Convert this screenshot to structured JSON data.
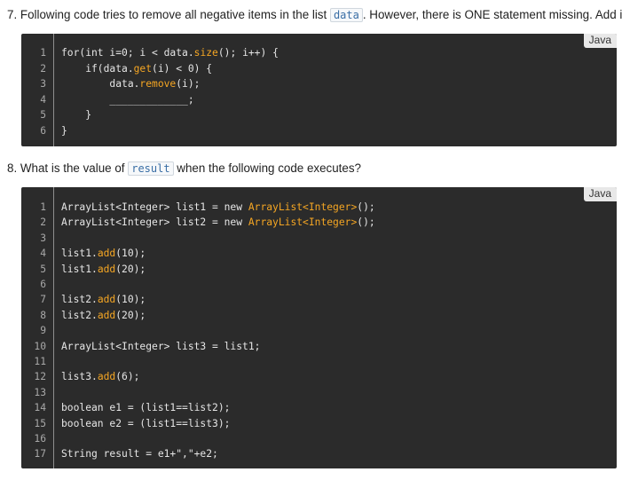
{
  "q7": {
    "prefix": "7. Following code tries to remove all negative items in the list ",
    "inline_code": "data",
    "suffix": ". However, there is ONE statement missing. Add it.",
    "language": "Java",
    "lines": [
      {
        "num": "1",
        "parts": [
          {
            "t": "for(int i=0; i < data.",
            "c": "plain"
          },
          {
            "t": "size",
            "c": "orange"
          },
          {
            "t": "(); i++) {",
            "c": "plain"
          }
        ]
      },
      {
        "num": "2",
        "parts": [
          {
            "t": "    if(data.",
            "c": "plain"
          },
          {
            "t": "get",
            "c": "orange"
          },
          {
            "t": "(i) < 0) {",
            "c": "plain"
          }
        ]
      },
      {
        "num": "3",
        "parts": [
          {
            "t": "        data.",
            "c": "plain"
          },
          {
            "t": "remove",
            "c": "orange"
          },
          {
            "t": "(i);",
            "c": "plain"
          }
        ]
      },
      {
        "num": "4",
        "parts": [
          {
            "t": "        _____________;",
            "c": "plain"
          }
        ]
      },
      {
        "num": "5",
        "parts": [
          {
            "t": "    }",
            "c": "plain"
          }
        ]
      },
      {
        "num": "6",
        "parts": [
          {
            "t": "}",
            "c": "plain"
          }
        ]
      }
    ]
  },
  "q8": {
    "prefix": "8. What is the value of ",
    "inline_code": "result",
    "suffix": " when the following code executes?",
    "language": "Java",
    "lines": [
      {
        "num": "1",
        "parts": [
          {
            "t": "ArrayList<Integer> list1 = new ",
            "c": "plain"
          },
          {
            "t": "ArrayList<Integer>",
            "c": "orange"
          },
          {
            "t": "();",
            "c": "plain"
          }
        ]
      },
      {
        "num": "2",
        "parts": [
          {
            "t": "ArrayList<Integer> list2 = new ",
            "c": "plain"
          },
          {
            "t": "ArrayList<Integer>",
            "c": "orange"
          },
          {
            "t": "();",
            "c": "plain"
          }
        ]
      },
      {
        "num": "3",
        "parts": []
      },
      {
        "num": "4",
        "parts": [
          {
            "t": "list1.",
            "c": "plain"
          },
          {
            "t": "add",
            "c": "orange"
          },
          {
            "t": "(10);",
            "c": "plain"
          }
        ]
      },
      {
        "num": "5",
        "parts": [
          {
            "t": "list1.",
            "c": "plain"
          },
          {
            "t": "add",
            "c": "orange"
          },
          {
            "t": "(20);",
            "c": "plain"
          }
        ]
      },
      {
        "num": "6",
        "parts": []
      },
      {
        "num": "7",
        "parts": [
          {
            "t": "list2.",
            "c": "plain"
          },
          {
            "t": "add",
            "c": "orange"
          },
          {
            "t": "(10);",
            "c": "plain"
          }
        ]
      },
      {
        "num": "8",
        "parts": [
          {
            "t": "list2.",
            "c": "plain"
          },
          {
            "t": "add",
            "c": "orange"
          },
          {
            "t": "(20);",
            "c": "plain"
          }
        ]
      },
      {
        "num": "9",
        "parts": []
      },
      {
        "num": "10",
        "parts": [
          {
            "t": "ArrayList<Integer> list3 = list1;",
            "c": "plain"
          }
        ]
      },
      {
        "num": "11",
        "parts": []
      },
      {
        "num": "12",
        "parts": [
          {
            "t": "list3.",
            "c": "plain"
          },
          {
            "t": "add",
            "c": "orange"
          },
          {
            "t": "(6);",
            "c": "plain"
          }
        ]
      },
      {
        "num": "13",
        "parts": []
      },
      {
        "num": "14",
        "parts": [
          {
            "t": "boolean e1 = (list1==list2);",
            "c": "plain"
          }
        ]
      },
      {
        "num": "15",
        "parts": [
          {
            "t": "boolean e2 = (list1==list3);",
            "c": "plain"
          }
        ]
      },
      {
        "num": "16",
        "parts": []
      },
      {
        "num": "17",
        "parts": [
          {
            "t": "String result = e1+\",\"+e2;",
            "c": "plain"
          }
        ]
      }
    ]
  },
  "colors": {
    "code_bg": "#2b2b2b",
    "keyword_orange": "#f5a623",
    "code_text": "#e6e6e6",
    "line_number": "#a8a8a8"
  }
}
